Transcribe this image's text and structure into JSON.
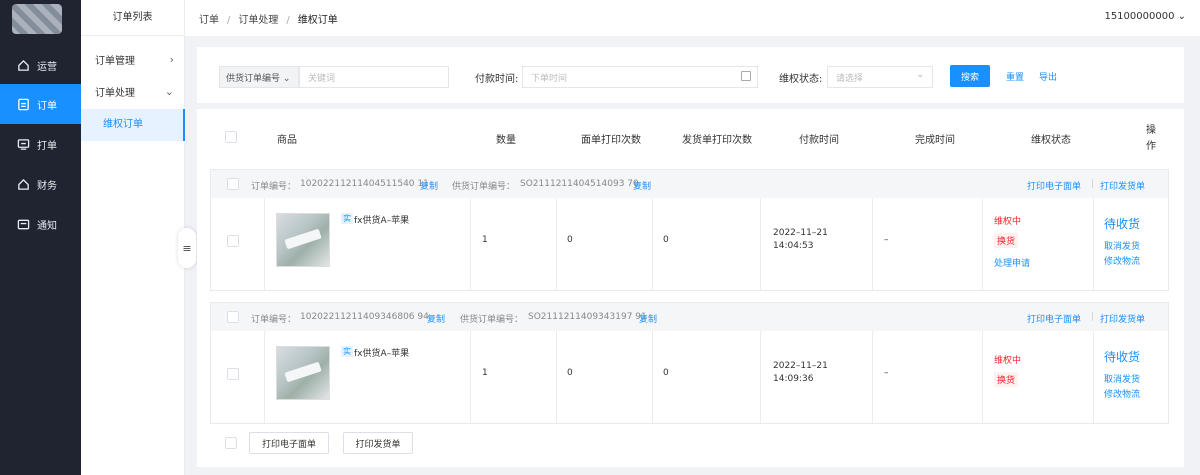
{
  "nav": {
    "items": [
      {
        "label": "运营",
        "icon": "home-icon"
      },
      {
        "label": "订单",
        "icon": "document-icon"
      },
      {
        "label": "打单",
        "icon": "printer-icon"
      },
      {
        "label": "财务",
        "icon": "finance-icon"
      },
      {
        "label": "通知",
        "icon": "message-icon"
      }
    ],
    "active_index": 1
  },
  "submenu": {
    "title": "订单列表",
    "groups": [
      {
        "label": "订单管理",
        "chevron": "›"
      },
      {
        "label": "订单处理",
        "chevron": "⌄"
      }
    ],
    "active_item": "维权订单"
  },
  "header": {
    "breadcrumb": [
      "订单",
      "订单处理",
      "维权订单"
    ],
    "user": "15100000000 ⌄"
  },
  "filters": {
    "order_type": "供货订单编号 ⌄",
    "keyword_placeholder": "关键词",
    "pay_time_label": "付款时间:",
    "pay_time_placeholder": "下单时间",
    "rights_status_label": "维权状态:",
    "rights_status_placeholder": "请选择",
    "search_label": "搜索",
    "reset_label": "重置",
    "export_label": "导出"
  },
  "table": {
    "columns": [
      "商品",
      "数量",
      "面单打印次数",
      "发货单打印次数",
      "付款时间",
      "完成时间",
      "维权状态",
      "操作"
    ]
  },
  "orders": [
    {
      "order_no_label": "订单编号：",
      "order_no": "10202211211404511540 11",
      "copy_label": "复制",
      "supply_no_label": "供货订单编号：",
      "supply_no": "SO2111211404514093 70",
      "print_waybill": "打印电子面单",
      "print_invoice": "打印发货单",
      "tag": "实",
      "product": "fx供货A–苹果",
      "quantity": "1",
      "waybill_count": "0",
      "invoice_count": "0",
      "pay_date": "2022–11–21",
      "pay_time": "14:04:53",
      "finish_time": "–",
      "rights_status": "维权中",
      "rights_type": "换货",
      "handle_link": "处理申请",
      "order_status": "待收货",
      "action1": "取消发货",
      "action2": "修改物流"
    },
    {
      "order_no_label": "订单编号：",
      "order_no": "10202211211409346806 94",
      "copy_label": "复制",
      "supply_no_label": "供货订单编号：",
      "supply_no": "SO2111211409343197 91",
      "print_waybill": "打印电子面单",
      "print_invoice": "打印发货单",
      "tag": "实",
      "product": "fx供货A–苹果",
      "quantity": "1",
      "waybill_count": "0",
      "invoice_count": "0",
      "pay_date": "2022–11–21",
      "pay_time": "14:09:36",
      "finish_time": "–",
      "rights_status": "维权中",
      "rights_type": "换货",
      "order_status": "待收货",
      "action1": "取消发货",
      "action2": "修改物流"
    }
  ],
  "bottom": {
    "print_waybill": "打印电子面单",
    "print_invoice": "打印发货单"
  }
}
